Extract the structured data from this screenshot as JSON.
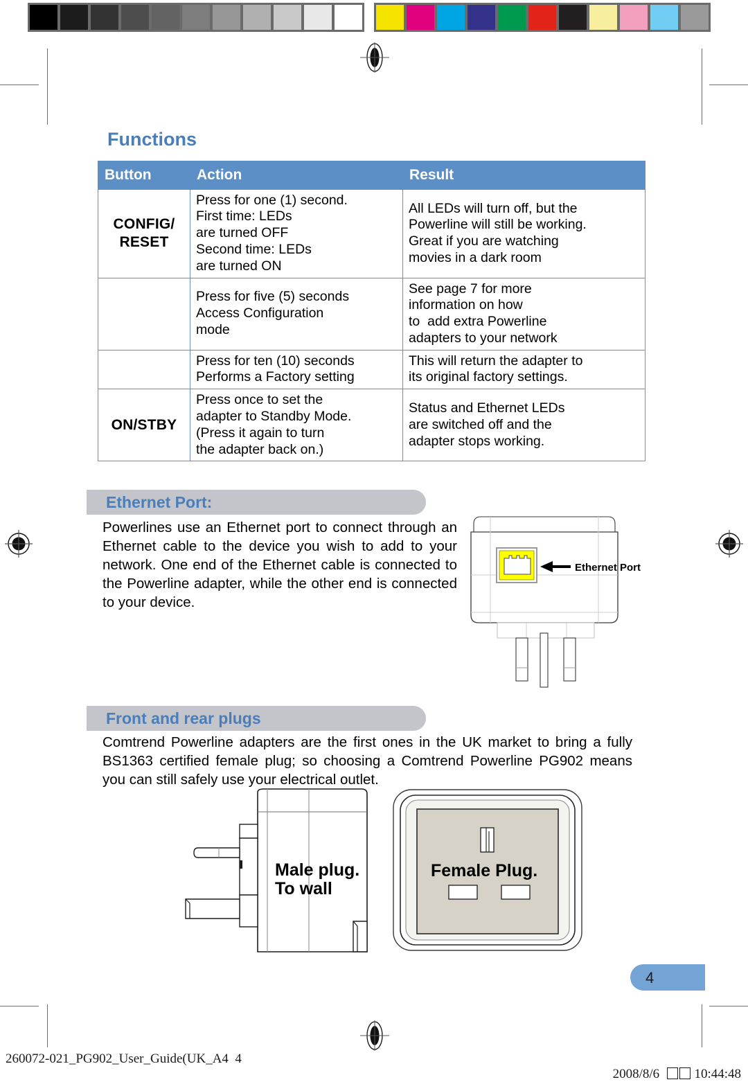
{
  "calibration_bar": {
    "grayscale": [
      "#000000",
      "#1c1c1c",
      "#333333",
      "#4d4d4d",
      "#636363",
      "#7d7d7d",
      "#969696",
      "#b0b0b0",
      "#c9c9c9",
      "#e8e8e8",
      "#ffffff"
    ],
    "colors": [
      "#f4e400",
      "#e1007d",
      "#00a5e3",
      "#33318a",
      "#009a4e",
      "#e2231a",
      "#231f20",
      "#f7ef9e",
      "#f2a0be",
      "#72cdf4",
      "#9a9a9a"
    ]
  },
  "section_title": "Functions",
  "table": {
    "headers": [
      "Button",
      "Action",
      "Result"
    ],
    "rows": [
      {
        "button": "CONFIG/\nRESET",
        "action": [
          "Press for one (1) second.",
          "First time: LEDs",
          "are turned OFF",
          "Second time: LEDs",
          "are turned ON"
        ],
        "result": [
          "All LEDs will turn off, but the",
          "Powerline will still be working.",
          "Great if you are watching",
          "movies in a dark room"
        ]
      },
      {
        "button": "",
        "action": [
          "Press for five (5) seconds",
          "Access Configuration",
          "mode"
        ],
        "result": [
          "See page 7 for more",
          "information on how",
          "to  add extra Powerline",
          "adapters to your network"
        ]
      },
      {
        "button": "",
        "action": [
          "Press for ten (10) seconds",
          "Performs a Factory setting"
        ],
        "result": [
          "This will return the adapter to",
          "its original factory settings."
        ]
      },
      {
        "button": "ON/STBY",
        "action": [
          "Press once to set the",
          "adapter to Standby Mode.",
          "(Press it again to turn",
          "the adapter back on.)"
        ],
        "result": [
          "Status and Ethernet LEDs",
          "are switched off and the",
          "adapter stops working."
        ]
      }
    ]
  },
  "ethernet_section": {
    "heading": "Ethernet Port:",
    "body": "Powerlines use an Ethernet port to connect through an Ethernet cable to the device you wish to add to your network.  One end of the Ethernet cable is connected to the Powerline adapter, while the other end is connected to your device.",
    "callout_label": "Ethernet Port"
  },
  "plugs_section": {
    "heading": "Front and rear plugs",
    "body": "Comtrend Powerline adapters are the first ones in the UK market to bring a fully BS1363 certified female plug; so choosing a Comtrend Powerline PG902 means you can still safely use your electrical outlet.",
    "male_label_line1": "Male plug.",
    "male_label_line2": "To wall",
    "female_label": "Female Plug."
  },
  "page_number": "4",
  "footer": {
    "left": "260072-021_PG902_User_Guide(UK_A4  4",
    "right_date": "2008/8/6",
    "right_time": "10:44:48"
  },
  "colors": {
    "accent_blue": "#4a7ebb",
    "table_header_blue": "#5b8fc6",
    "section_bar_gray": "#c3c5ca",
    "page_tab_blue": "#74a3d6",
    "port_yellow": "#ffff00"
  }
}
